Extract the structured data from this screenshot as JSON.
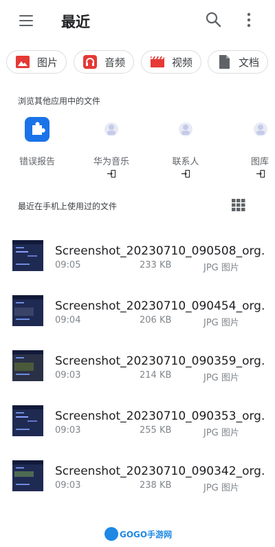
{
  "header": {
    "title": "最近"
  },
  "chips": [
    {
      "label": "图片",
      "icon": "image-icon",
      "color": "#e53935"
    },
    {
      "label": "音频",
      "icon": "headphones-icon",
      "color": "#e53935"
    },
    {
      "label": "视频",
      "icon": "movie-icon",
      "color": "#e53935"
    },
    {
      "label": "文档",
      "icon": "document-icon",
      "color": "#5f6368"
    }
  ],
  "browse_section": {
    "title": "浏览其他应用中的文件"
  },
  "apps": [
    {
      "label": "错误报告",
      "icon": "puzzle-icon",
      "color": "#1a73e8"
    },
    {
      "label": "华为音乐",
      "icon": "placeholder-app-icon"
    },
    {
      "label": "联系人",
      "icon": "placeholder-app-icon"
    },
    {
      "label": "图库",
      "icon": "placeholder-app-icon"
    }
  ],
  "recent_section": {
    "title": "最近在手机上使用过的文件"
  },
  "files": [
    {
      "name": "Screenshot_20230710_090508_org....",
      "time": "09:05",
      "size": "233 KB",
      "type": "JPG 图片"
    },
    {
      "name": "Screenshot_20230710_090454_org....",
      "time": "09:04",
      "size": "206 KB",
      "type": "JPG 图片"
    },
    {
      "name": "Screenshot_20230710_090359_org....",
      "time": "09:03",
      "size": "214 KB",
      "type": "JPG 图片"
    },
    {
      "name": "Screenshot_20230710_090353_org....",
      "time": "09:03",
      "size": "255 KB",
      "type": "JPG 图片"
    },
    {
      "name": "Screenshot_20230710_090342_org....",
      "time": "09:03",
      "size": "238 KB",
      "type": "JPG 图片"
    }
  ],
  "watermark": {
    "text": "GOGO手游网"
  }
}
